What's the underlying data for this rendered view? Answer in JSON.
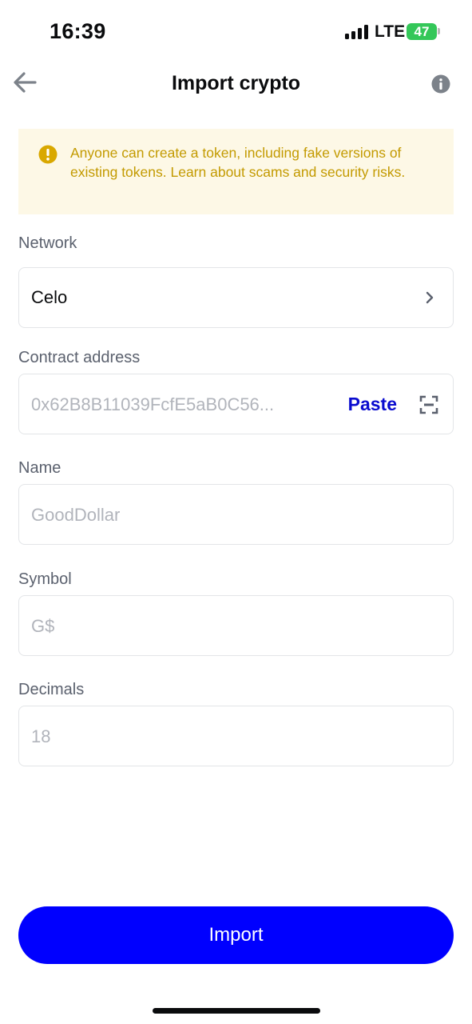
{
  "status_bar": {
    "time": "16:39",
    "network": "LTE",
    "battery": "47"
  },
  "header": {
    "title": "Import crypto",
    "back_icon": "arrow-left-icon",
    "info_icon": "info-icon"
  },
  "warning": {
    "icon": "exclamation-circle-icon",
    "text": "Anyone can create a token, including fake versions of existing tokens. Learn about scams and security risks."
  },
  "form": {
    "network": {
      "label": "Network",
      "value": "Celo",
      "icon": "chevron-right-icon"
    },
    "contract_address": {
      "label": "Contract address",
      "placeholder": "0x62B8B11039FcfE5aB0C56...",
      "paste_label": "Paste",
      "scan_icon": "qr-scan-icon"
    },
    "name": {
      "label": "Name",
      "placeholder": "GoodDollar"
    },
    "symbol": {
      "label": "Symbol",
      "placeholder": "G$"
    },
    "decimals": {
      "label": "Decimals",
      "placeholder": "18"
    }
  },
  "import_button": {
    "label": "Import"
  },
  "colors": {
    "primary": "#0000ff",
    "link": "#0a0ccf",
    "warning_bg": "#fdf8e6",
    "warning_text": "#c39a00",
    "battery": "#34c759"
  }
}
